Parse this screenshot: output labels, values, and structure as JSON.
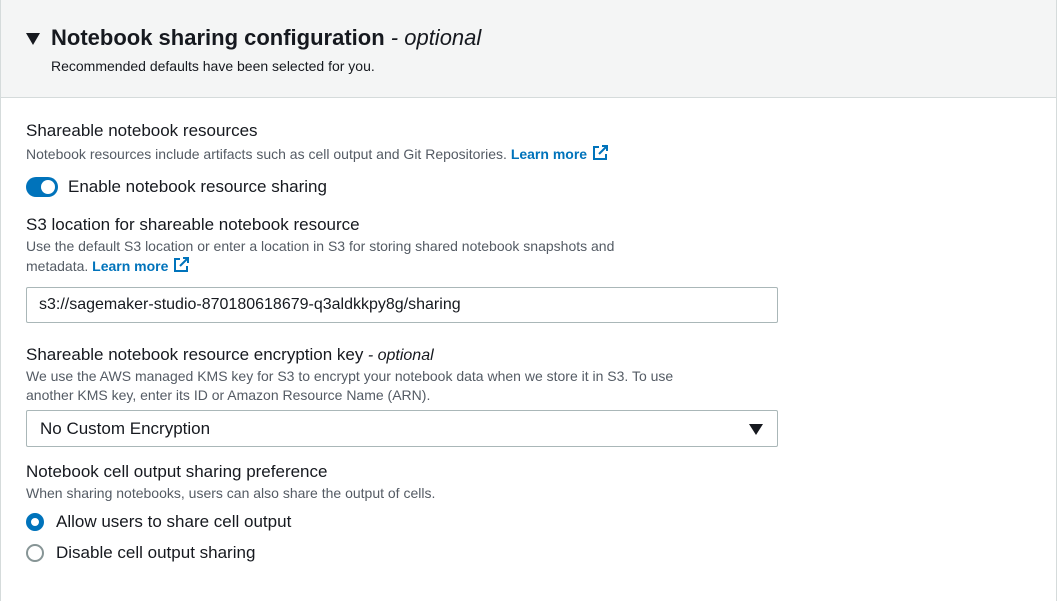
{
  "section": {
    "title": "Notebook sharing configuration",
    "title_optional": " - optional",
    "description": "Recommended defaults have been selected for you."
  },
  "resources": {
    "label": "Shareable notebook resources",
    "description": "Notebook resources include artifacts such as cell output and Git Repositories.",
    "learn_more": "Learn more",
    "toggle_label": "Enable notebook resource sharing",
    "toggle_on": true
  },
  "s3": {
    "label": "S3 location for shareable notebook resource",
    "description_line1": "Use the default S3 location or enter a location in S3 for storing shared notebook snapshots and",
    "description_line2": "metadata.",
    "learn_more": "Learn more",
    "value": "s3://sagemaker-studio-870180618679-q3aldkkpy8g/sharing"
  },
  "encryption": {
    "label": "Shareable notebook resource encryption key",
    "label_optional": " - optional",
    "description_line1": "We use the AWS managed KMS key for S3 to encrypt your notebook data when we store it in S3. To use",
    "description_line2": "another KMS key, enter its ID or Amazon Resource Name (ARN).",
    "selected": "No Custom Encryption"
  },
  "cell_output": {
    "label": "Notebook cell output sharing preference",
    "description": "When sharing notebooks, users can also share the output of cells.",
    "options": [
      {
        "label": "Allow users to share cell output",
        "checked": true
      },
      {
        "label": "Disable cell output sharing",
        "checked": false
      }
    ]
  },
  "colors": {
    "accent": "#0073bb",
    "header_bg": "#f4f5f5",
    "border": "#aab7b8"
  },
  "icons": {
    "collapse": "caret-down-icon",
    "external_link": "external-link-icon",
    "dropdown": "dropdown-caret-icon"
  }
}
